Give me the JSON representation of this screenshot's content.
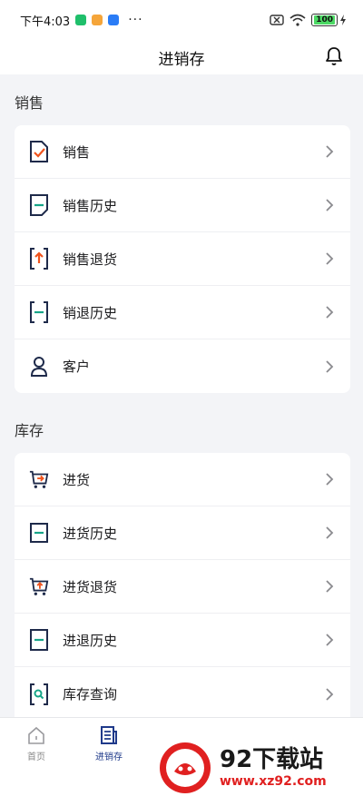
{
  "status_bar": {
    "time": "下午4:03",
    "more": "···",
    "battery": "100"
  },
  "header": {
    "title": "进销存"
  },
  "sections": [
    {
      "title": "销售",
      "items": [
        {
          "label": "销售",
          "icon": "sales-check-icon"
        },
        {
          "label": "销售历史",
          "icon": "sales-history-icon"
        },
        {
          "label": "销售退货",
          "icon": "sales-return-icon"
        },
        {
          "label": "销退历史",
          "icon": "return-history-icon"
        },
        {
          "label": "客户",
          "icon": "customer-icon"
        }
      ]
    },
    {
      "title": "库存",
      "items": [
        {
          "label": "进货",
          "icon": "purchase-cart-icon"
        },
        {
          "label": "进货历史",
          "icon": "purchase-history-icon"
        },
        {
          "label": "进货退货",
          "icon": "purchase-return-icon"
        },
        {
          "label": "进退历史",
          "icon": "purchase-return-history-icon"
        },
        {
          "label": "库存查询",
          "icon": "inventory-search-icon"
        }
      ]
    }
  ],
  "tabs": [
    {
      "label": "首页",
      "icon": "home-icon"
    },
    {
      "label": "进销存",
      "icon": "document-icon",
      "active": true
    }
  ],
  "gesture": "≡",
  "watermark": {
    "title": "92下载站",
    "url": "www.xz92.com"
  },
  "colors": {
    "accent": "#1f3a8a",
    "orange": "#f0541e",
    "teal": "#17a589",
    "icon_dark": "#1e2a4a"
  }
}
